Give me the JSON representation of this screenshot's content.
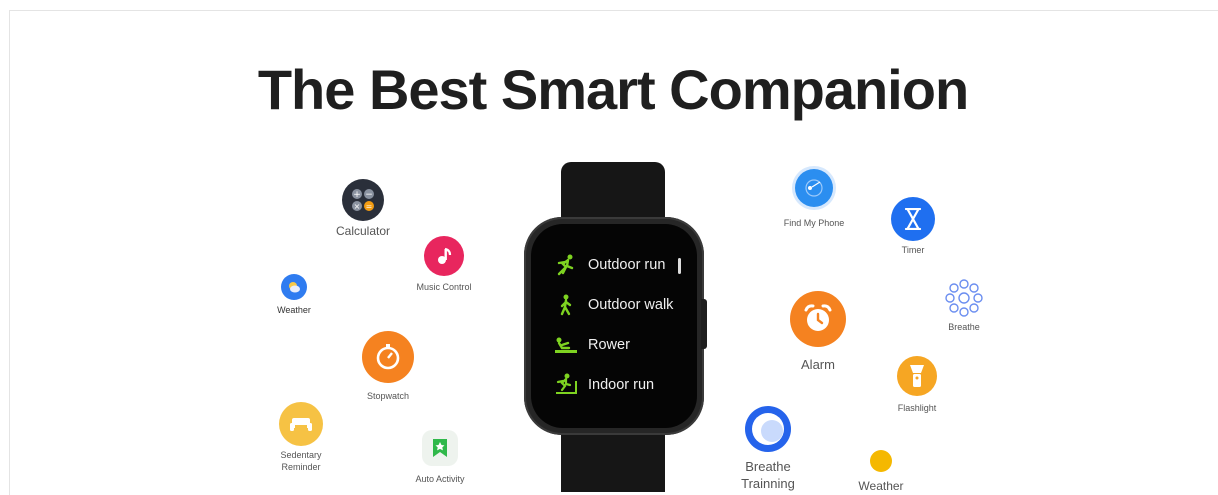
{
  "title": "The Best Smart Companion",
  "watch": {
    "items": [
      {
        "label": "Outdoor run",
        "icon": "running-icon"
      },
      {
        "label": "Outdoor walk",
        "icon": "walking-icon"
      },
      {
        "label": "Rower",
        "icon": "rower-icon"
      },
      {
        "label": "Indoor run",
        "icon": "treadmill-icon"
      }
    ]
  },
  "features": {
    "calculator": "Calculator",
    "music_control": "Music Control",
    "weather_left": "Weather",
    "stopwatch": "Stopwatch",
    "sedentary_reminder_1": "Sedentary",
    "sedentary_reminder_2": "Reminder",
    "auto_activity": "Auto Activity",
    "find_my_phone": "Find My Phone",
    "timer": "Timer",
    "breathe": "Breathe",
    "alarm": "Alarm",
    "flashlight": "Flashlight",
    "breathe_training_1": "Breathe",
    "breathe_training_2": "Trainning",
    "weather_right": "Weather"
  },
  "colors": {
    "title": "#1f1f1f",
    "watch_green": "#7ed321",
    "music": "#e8265e",
    "stopwatch": "#f58220",
    "alarm": "#f58220",
    "sedentary": "#f6c244",
    "auto_activity": "#2fb84a",
    "find_phone": "#2b8ef0",
    "timer": "#1f6ff0",
    "breathe": "#6b8ef0",
    "flashlight": "#f6a623",
    "breathe_training": "#2563eb",
    "weather_right": "#f5b800",
    "weather_left": "#2f7cf0"
  }
}
